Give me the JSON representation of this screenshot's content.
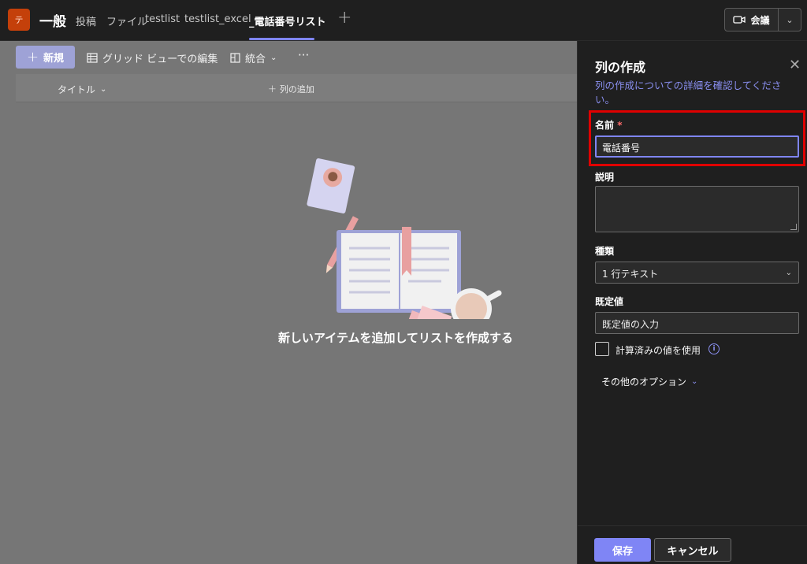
{
  "header": {
    "team_avatar": "テ",
    "channel": "一般",
    "tabs": [
      {
        "label": "投稿"
      },
      {
        "label": "ファイル"
      },
      {
        "label": "testlist"
      },
      {
        "label": "testlist_excel"
      },
      {
        "label": "_電話番号リスト"
      }
    ],
    "add_tab": "+",
    "meet_label": "会議"
  },
  "toolbar": {
    "new_label": "新規",
    "grid_edit_label": "グリッド ビューでの編集",
    "integrate_label": "統合",
    "more_label": "···"
  },
  "list": {
    "col_title": "タイトル",
    "add_column": "列の追加",
    "empty_message": "新しいアイテムを追加してリストを作成する"
  },
  "panel": {
    "title": "列の作成",
    "link": "列の作成についての詳細を確認してください。",
    "name_label": "名前",
    "required_mark": "*",
    "name_value": "電話番号",
    "description_label": "説明",
    "type_label": "種類",
    "type_value": "1 行テキスト",
    "default_label": "既定値",
    "default_placeholder": "既定値の入力",
    "calc_label": "計算済みの値を使用",
    "info_glyph": "i",
    "more_options": "その他のオプション",
    "save_label": "保存",
    "cancel_label": "キャンセル"
  },
  "colors": {
    "accent": "#7f85f5",
    "highlight": "#e00000",
    "team": "#c4400a"
  }
}
